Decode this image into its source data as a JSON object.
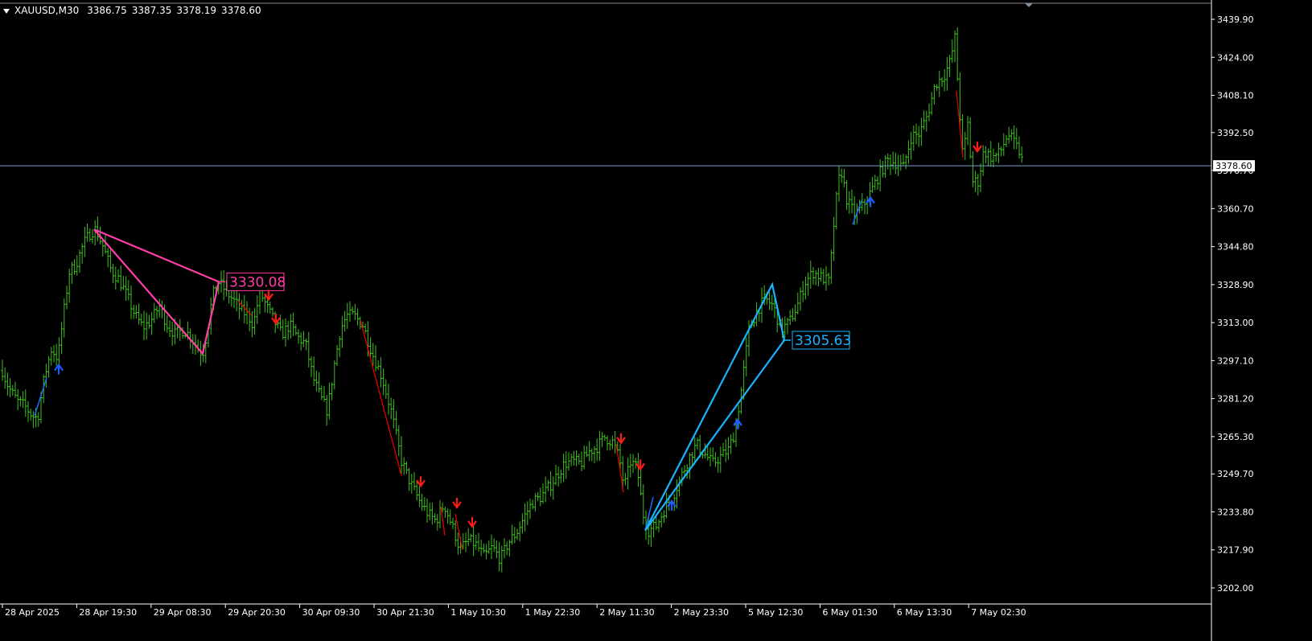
{
  "header": {
    "symbol_tf": "XAUUSD,M30",
    "open": "3386.75",
    "high": "3387.35",
    "low": "3378.19",
    "close": "3378.60"
  },
  "colors": {
    "background": "#000000",
    "bull_bar": "#3fbf1f",
    "bear_bar": "#3fbf1f",
    "down_swing": "#e00000",
    "up_swing": "#1e6cff",
    "pattern_pink": "#ff3fa8",
    "pattern_cyan": "#19b4ff",
    "price_line": "#6f9fcf",
    "arrow_sell": "#ff1a1a",
    "arrow_buy": "#1e5bff",
    "axis_text": "#ffffff"
  },
  "chart_data": {
    "type": "ohlc",
    "ylim": [
      3194.0,
      3445.0
    ],
    "y_ticks": [
      "3439.90",
      "3424.00",
      "3408.10",
      "3392.50",
      "3376.70",
      "3360.70",
      "3344.80",
      "3328.90",
      "3313.00",
      "3297.10",
      "3281.20",
      "3265.30",
      "3249.70",
      "3233.80",
      "3217.90",
      "3202.00"
    ],
    "x_ticks": [
      "28 Apr 2025",
      "28 Apr 19:30",
      "29 Apr 08:30",
      "29 Apr 20:30",
      "30 Apr 09:30",
      "30 Apr 21:30",
      "1 May 10:30",
      "1 May 22:30",
      "2 May 11:30",
      "2 May 23:30",
      "5 May 12:30",
      "6 May 01:30",
      "6 May 13:30",
      "7 May 02:30"
    ],
    "current_price": "3378.60",
    "path": [
      [
        0,
        3296
      ],
      [
        8,
        3288
      ],
      [
        14,
        3284
      ],
      [
        22,
        3280
      ],
      [
        31,
        3278
      ],
      [
        40,
        3274
      ],
      [
        47,
        3273
      ],
      [
        55,
        3290
      ],
      [
        64,
        3302
      ],
      [
        72,
        3298
      ],
      [
        78,
        3314
      ],
      [
        86,
        3334
      ],
      [
        94,
        3337
      ],
      [
        104,
        3346
      ],
      [
        113,
        3351
      ],
      [
        119,
        3352
      ],
      [
        128,
        3345
      ],
      [
        138,
        3335
      ],
      [
        148,
        3331
      ],
      [
        158,
        3324
      ],
      [
        168,
        3316
      ],
      [
        178,
        3311
      ],
      [
        188,
        3314
      ],
      [
        198,
        3320
      ],
      [
        208,
        3312
      ],
      [
        218,
        3308
      ],
      [
        228,
        3310
      ],
      [
        238,
        3307
      ],
      [
        246,
        3302
      ],
      [
        252,
        3300
      ],
      [
        258,
        3310
      ],
      [
        264,
        3324
      ],
      [
        272,
        3330
      ],
      [
        281,
        3326
      ],
      [
        291,
        3322
      ],
      [
        300,
        3318
      ],
      [
        308,
        3316
      ],
      [
        315,
        3312
      ],
      [
        323,
        3326
      ],
      [
        331,
        3320
      ],
      [
        340,
        3314
      ],
      [
        350,
        3308
      ],
      [
        360,
        3312
      ],
      [
        370,
        3307
      ],
      [
        380,
        3304
      ],
      [
        389,
        3290
      ],
      [
        398,
        3282
      ],
      [
        407,
        3276
      ],
      [
        415,
        3294
      ],
      [
        423,
        3310
      ],
      [
        431,
        3316
      ],
      [
        440,
        3316
      ],
      [
        451,
        3312
      ],
      [
        463,
        3300
      ],
      [
        475,
        3290
      ],
      [
        487,
        3275
      ],
      [
        499,
        3255
      ],
      [
        510,
        3246
      ],
      [
        522,
        3238
      ],
      [
        532,
        3233
      ],
      [
        542,
        3230
      ],
      [
        552,
        3237
      ],
      [
        562,
        3228
      ],
      [
        572,
        3218
      ],
      [
        582,
        3222
      ],
      [
        592,
        3220
      ],
      [
        602,
        3215
      ],
      [
        612,
        3219
      ],
      [
        622,
        3214
      ],
      [
        632,
        3221
      ],
      [
        642,
        3225
      ],
      [
        652,
        3232
      ],
      [
        662,
        3238
      ],
      [
        672,
        3240
      ],
      [
        682,
        3244
      ],
      [
        692,
        3249
      ],
      [
        702,
        3254
      ],
      [
        712,
        3255
      ],
      [
        722,
        3254
      ],
      [
        732,
        3259
      ],
      [
        742,
        3261
      ],
      [
        752,
        3265
      ],
      [
        762,
        3263
      ],
      [
        770,
        3256
      ],
      [
        776,
        3244
      ],
      [
        784,
        3255
      ],
      [
        792,
        3252
      ],
      [
        800,
        3232
      ],
      [
        806,
        3226
      ],
      [
        816,
        3228
      ],
      [
        826,
        3235
      ],
      [
        836,
        3240
      ],
      [
        846,
        3248
      ],
      [
        856,
        3256
      ],
      [
        866,
        3262
      ],
      [
        876,
        3258
      ],
      [
        886,
        3254
      ],
      [
        896,
        3257
      ],
      [
        906,
        3260
      ],
      [
        914,
        3268
      ],
      [
        922,
        3286
      ],
      [
        931,
        3310
      ],
      [
        941,
        3318
      ],
      [
        951,
        3323
      ],
      [
        961,
        3320
      ],
      [
        971,
        3310
      ],
      [
        981,
        3313
      ],
      [
        991,
        3320
      ],
      [
        1001,
        3330
      ],
      [
        1011,
        3334
      ],
      [
        1021,
        3332
      ],
      [
        1031,
        3330
      ],
      [
        1038,
        3360
      ],
      [
        1045,
        3378
      ],
      [
        1053,
        3364
      ],
      [
        1063,
        3358
      ],
      [
        1073,
        3362
      ],
      [
        1083,
        3368
      ],
      [
        1093,
        3375
      ],
      [
        1103,
        3381
      ],
      [
        1113,
        3380
      ],
      [
        1123,
        3378
      ],
      [
        1133,
        3391
      ],
      [
        1143,
        3392
      ],
      [
        1153,
        3400
      ],
      [
        1163,
        3413
      ],
      [
        1173,
        3416
      ],
      [
        1181,
        3422
      ],
      [
        1187,
        3432
      ],
      [
        1192,
        3406
      ],
      [
        1197,
        3382
      ],
      [
        1203,
        3396
      ],
      [
        1209,
        3372
      ],
      [
        1216,
        3372
      ],
      [
        1223,
        3385
      ],
      [
        1233,
        3382
      ],
      [
        1243,
        3384
      ],
      [
        1253,
        3392
      ],
      [
        1261,
        3388
      ],
      [
        1268,
        3384
      ],
      [
        1272,
        3378.6
      ]
    ],
    "swings_down": [
      [
        [
          448,
          3314
        ],
        [
          499,
          3249
        ]
      ],
      [
        [
          296,
          3322
        ],
        [
          313,
          3316
        ]
      ],
      [
        [
          766,
          3262
        ],
        [
          775,
          3242
        ]
      ],
      [
        [
          1189,
          3410
        ],
        [
          1197,
          3382
        ]
      ],
      [
        [
          548,
          3236
        ],
        [
          553,
          3224
        ]
      ],
      [
        [
          566,
          3233
        ],
        [
          575,
          3218
        ]
      ]
    ],
    "swings_up": [
      [
        [
          43,
          3274
        ],
        [
          58,
          3290
        ]
      ],
      [
        [
          802,
          3226
        ],
        [
          812,
          3240
        ]
      ],
      [
        [
          1060,
          3354
        ],
        [
          1071,
          3364
        ]
      ]
    ],
    "patterns": [
      {
        "label": "3330.08",
        "color": "#ff3fa8",
        "points": [
          [
            117,
            3352
          ],
          [
            272,
            3330.08
          ],
          [
            252,
            3300
          ],
          [
            117,
            3352
          ]
        ],
        "label_at": [
          282,
          3330.08
        ]
      },
      {
        "label": "3305.63",
        "color": "#19b4ff",
        "points": [
          [
            802,
            3226
          ],
          [
            960,
            3329
          ],
          [
            975,
            3305.63
          ],
          [
            802,
            3226
          ]
        ],
        "label_at": [
          985,
          3305.63
        ]
      }
    ],
    "sell_arrows": [
      [
        334,
        3324
      ],
      [
        343,
        3314
      ],
      [
        523,
        3246
      ],
      [
        568,
        3237
      ],
      [
        587,
        3229
      ],
      [
        772,
        3264
      ],
      [
        796,
        3253
      ],
      [
        1215,
        3386
      ]
    ],
    "buy_arrows": [
      [
        73,
        3294
      ],
      [
        1082,
        3364
      ],
      [
        917,
        3271
      ],
      [
        835,
        3237
      ]
    ]
  }
}
